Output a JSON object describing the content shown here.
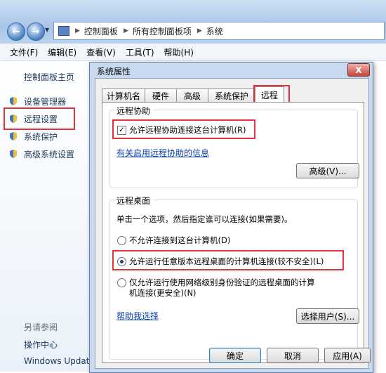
{
  "address": {
    "segments": [
      "控制面板",
      "所有控制面板项",
      "系统"
    ]
  },
  "menu": [
    "文件(F)",
    "编辑(E)",
    "查看(V)",
    "工具(T)",
    "帮助(H)"
  ],
  "sidebar": {
    "home": "控制面板主页",
    "items": [
      {
        "label": "设备管理器"
      },
      {
        "label": "远程设置"
      },
      {
        "label": "系统保护"
      },
      {
        "label": "高级系统设置"
      }
    ],
    "see_also_title": "另请参阅",
    "see_also": [
      "操作中心",
      "Windows Updat"
    ]
  },
  "dialog": {
    "title": "系统属性",
    "close": "X",
    "tabs": [
      "计算机名",
      "硬件",
      "高级",
      "系统保护",
      "远程"
    ],
    "assist": {
      "title": "远程协助",
      "allow_label": "允许远程协助连接这台计算机(R)",
      "allow_checked": true,
      "info_link": "有关启用远程协助的信息",
      "advanced_button": "高级(V)..."
    },
    "desktop": {
      "title": "远程桌面",
      "instruction": "单击一个选项，然后指定谁可以连接(如果需要)。",
      "options": [
        {
          "label": "不允许连接到这台计算机(D)",
          "selected": false
        },
        {
          "label": "允许运行任意版本远程桌面的计算机连接(较不安全)(L)",
          "selected": true
        },
        {
          "label_line1": "仅允许运行使用网络级别身份验证的远程桌面的计算",
          "label_line2": "机连接(更安全)(N)",
          "selected": false
        }
      ],
      "help_link": "帮助我选择",
      "select_users_button": "选择用户(S)..."
    },
    "buttons": {
      "ok": "确定",
      "cancel": "取消",
      "apply": "应用(A)"
    }
  },
  "colors": {
    "highlight": "#e5313b",
    "link": "#0b3fa8"
  }
}
